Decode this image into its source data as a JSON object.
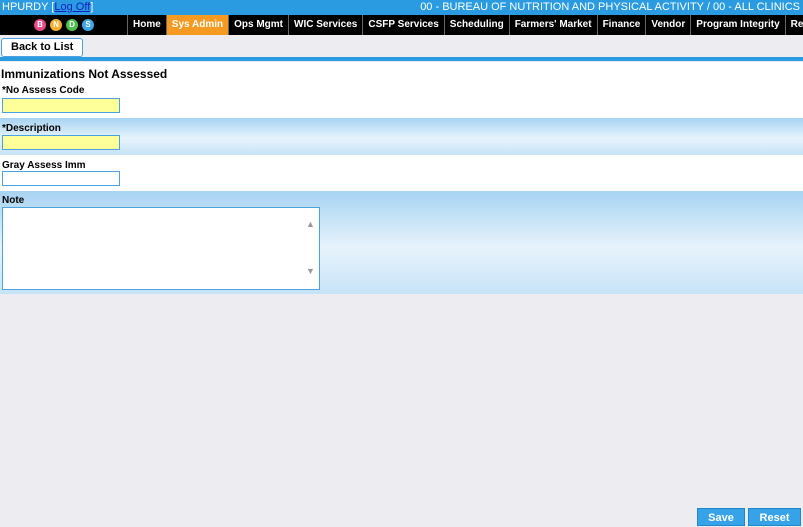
{
  "header": {
    "user": "HPURDY",
    "logoff_label": "Log Off",
    "org": "00 - BUREAU OF NUTRITION AND PHYSICAL ACTIVITY / 00 - ALL CLINICS",
    "logo_letters": [
      "B",
      "N",
      "D",
      "S"
    ],
    "colors": {
      "topbar": "#2a9be0",
      "active_tab": "#f79a22",
      "navbar": "#000000"
    }
  },
  "nav": [
    {
      "label": "Home",
      "active": false
    },
    {
      "label": "Sys Admin",
      "active": true
    },
    {
      "label": "Ops Mgmt",
      "active": false
    },
    {
      "label": "WIC Services",
      "active": false
    },
    {
      "label": "CSFP Services",
      "active": false
    },
    {
      "label": "Scheduling",
      "active": false
    },
    {
      "label": "Farmers' Market",
      "active": false
    },
    {
      "label": "Finance",
      "active": false
    },
    {
      "label": "Vendor",
      "active": false
    },
    {
      "label": "Program Integrity",
      "active": false
    },
    {
      "label": "Reports",
      "active": false
    }
  ],
  "toolbar": {
    "back_label": "Back to List"
  },
  "form": {
    "title": "Immunizations Not Assessed",
    "no_assess_code": {
      "label": "*No Assess Code",
      "value": ""
    },
    "description": {
      "label": "*Description",
      "value": ""
    },
    "gray_assess": {
      "label": "Gray Assess Imm",
      "value": ""
    },
    "note": {
      "label": "Note",
      "value": ""
    }
  },
  "footer": {
    "save_label": "Save",
    "reset_label": "Reset"
  }
}
